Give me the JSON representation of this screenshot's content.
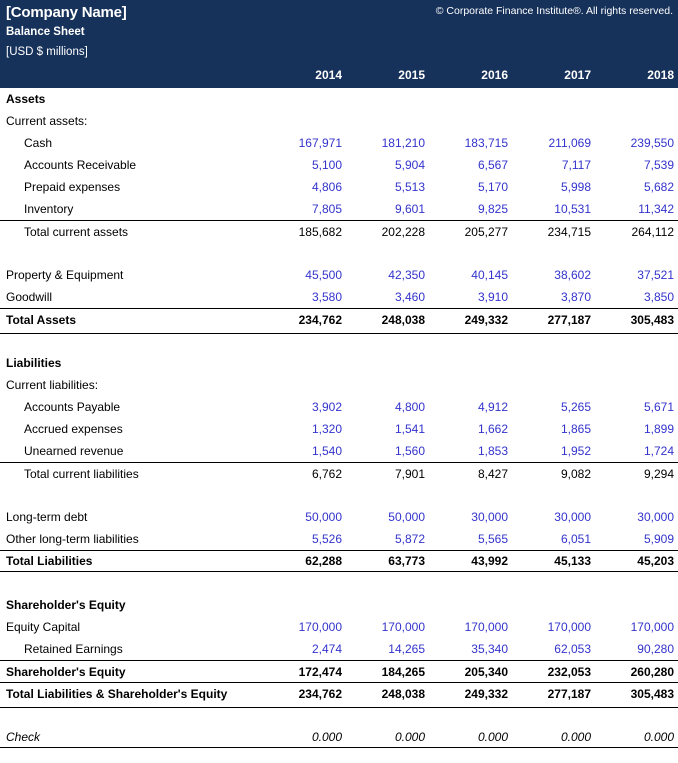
{
  "header": {
    "company_name": "[Company Name]",
    "statement_title": "Balance Sheet",
    "units": "[USD $ millions]",
    "copyright": "© Corporate Finance Institute®. All rights reserved.",
    "background_color": "#16315A",
    "text_color": "#FFFFFF"
  },
  "colors": {
    "navy": "#16315A",
    "input_blue": "#3333CC",
    "formula_black": "#000000"
  },
  "columns": [
    "2014",
    "2015",
    "2016",
    "2017",
    "2018"
  ],
  "rows": [
    {
      "label": "Assets",
      "style": "section-heading",
      "values": [
        "",
        "",
        "",
        "",
        ""
      ]
    },
    {
      "label": "Current assets:",
      "style": "sub-heading",
      "values": [
        "",
        "",
        "",
        "",
        ""
      ]
    },
    {
      "label": "Cash",
      "style": "input",
      "values": [
        "167,971",
        "181,210",
        "183,715",
        "211,069",
        "239,550"
      ]
    },
    {
      "label": "Accounts Receivable",
      "style": "input",
      "values": [
        "5,100",
        "5,904",
        "6,567",
        "7,117",
        "7,539"
      ]
    },
    {
      "label": "Prepaid expenses",
      "style": "input",
      "values": [
        "4,806",
        "5,513",
        "5,170",
        "5,998",
        "5,682"
      ]
    },
    {
      "label": "Inventory",
      "style": "input",
      "values": [
        "7,805",
        "9,601",
        "9,825",
        "10,531",
        "11,342"
      ]
    },
    {
      "label": "Total current assets",
      "style": "subtotal",
      "values": [
        "185,682",
        "202,228",
        "205,277",
        "234,715",
        "264,112"
      ]
    },
    {
      "label": "Property & Equipment",
      "style": "input",
      "values": [
        "45,500",
        "42,350",
        "40,145",
        "38,602",
        "37,521"
      ]
    },
    {
      "label": "Goodwill",
      "style": "input",
      "values": [
        "3,580",
        "3,460",
        "3,910",
        "3,870",
        "3,850"
      ]
    },
    {
      "label": "Total Assets",
      "style": "grand-total",
      "values": [
        "234,762",
        "248,038",
        "249,332",
        "277,187",
        "305,483"
      ]
    },
    {
      "label": "Liabilities",
      "style": "section-heading",
      "values": [
        "",
        "",
        "",
        "",
        ""
      ]
    },
    {
      "label": "Current liabilities:",
      "style": "sub-heading",
      "values": [
        "",
        "",
        "",
        "",
        ""
      ]
    },
    {
      "label": "Accounts Payable",
      "style": "input",
      "values": [
        "3,902",
        "4,800",
        "4,912",
        "5,265",
        "5,671"
      ]
    },
    {
      "label": "Accrued expenses",
      "style": "input",
      "values": [
        "1,320",
        "1,541",
        "1,662",
        "1,865",
        "1,899"
      ]
    },
    {
      "label": "Unearned revenue",
      "style": "input",
      "values": [
        "1,540",
        "1,560",
        "1,853",
        "1,952",
        "1,724"
      ]
    },
    {
      "label": "Total current liabilities",
      "style": "subtotal",
      "values": [
        "6,762",
        "7,901",
        "8,427",
        "9,082",
        "9,294"
      ]
    },
    {
      "label": "Long-term debt",
      "style": "input",
      "values": [
        "50,000",
        "50,000",
        "30,000",
        "30,000",
        "30,000"
      ]
    },
    {
      "label": "Other long-term liabilities",
      "style": "input",
      "values": [
        "5,526",
        "5,872",
        "5,565",
        "6,051",
        "5,909"
      ]
    },
    {
      "label": "Total Liabilities",
      "style": "total",
      "values": [
        "62,288",
        "63,773",
        "43,992",
        "45,133",
        "45,203"
      ]
    },
    {
      "label": "Shareholder's Equity",
      "style": "section-heading",
      "values": [
        "",
        "",
        "",
        "",
        ""
      ]
    },
    {
      "label": "Equity Capital",
      "style": "input",
      "values": [
        "170,000",
        "170,000",
        "170,000",
        "170,000",
        "170,000"
      ]
    },
    {
      "label": "Retained Earnings",
      "style": "input",
      "values": [
        "2,474",
        "14,265",
        "35,340",
        "62,053",
        "90,280"
      ]
    },
    {
      "label": "Shareholder's Equity",
      "style": "total",
      "values": [
        "172,474",
        "184,265",
        "205,340",
        "232,053",
        "260,280"
      ]
    },
    {
      "label": "Total Liabilities & Shareholder's Equity",
      "style": "grand-total",
      "values": [
        "234,762",
        "248,038",
        "249,332",
        "277,187",
        "305,483"
      ]
    },
    {
      "label": "Check",
      "style": "check",
      "values": [
        "0.000",
        "0.000",
        "0.000",
        "0.000",
        "0.000"
      ]
    }
  ]
}
